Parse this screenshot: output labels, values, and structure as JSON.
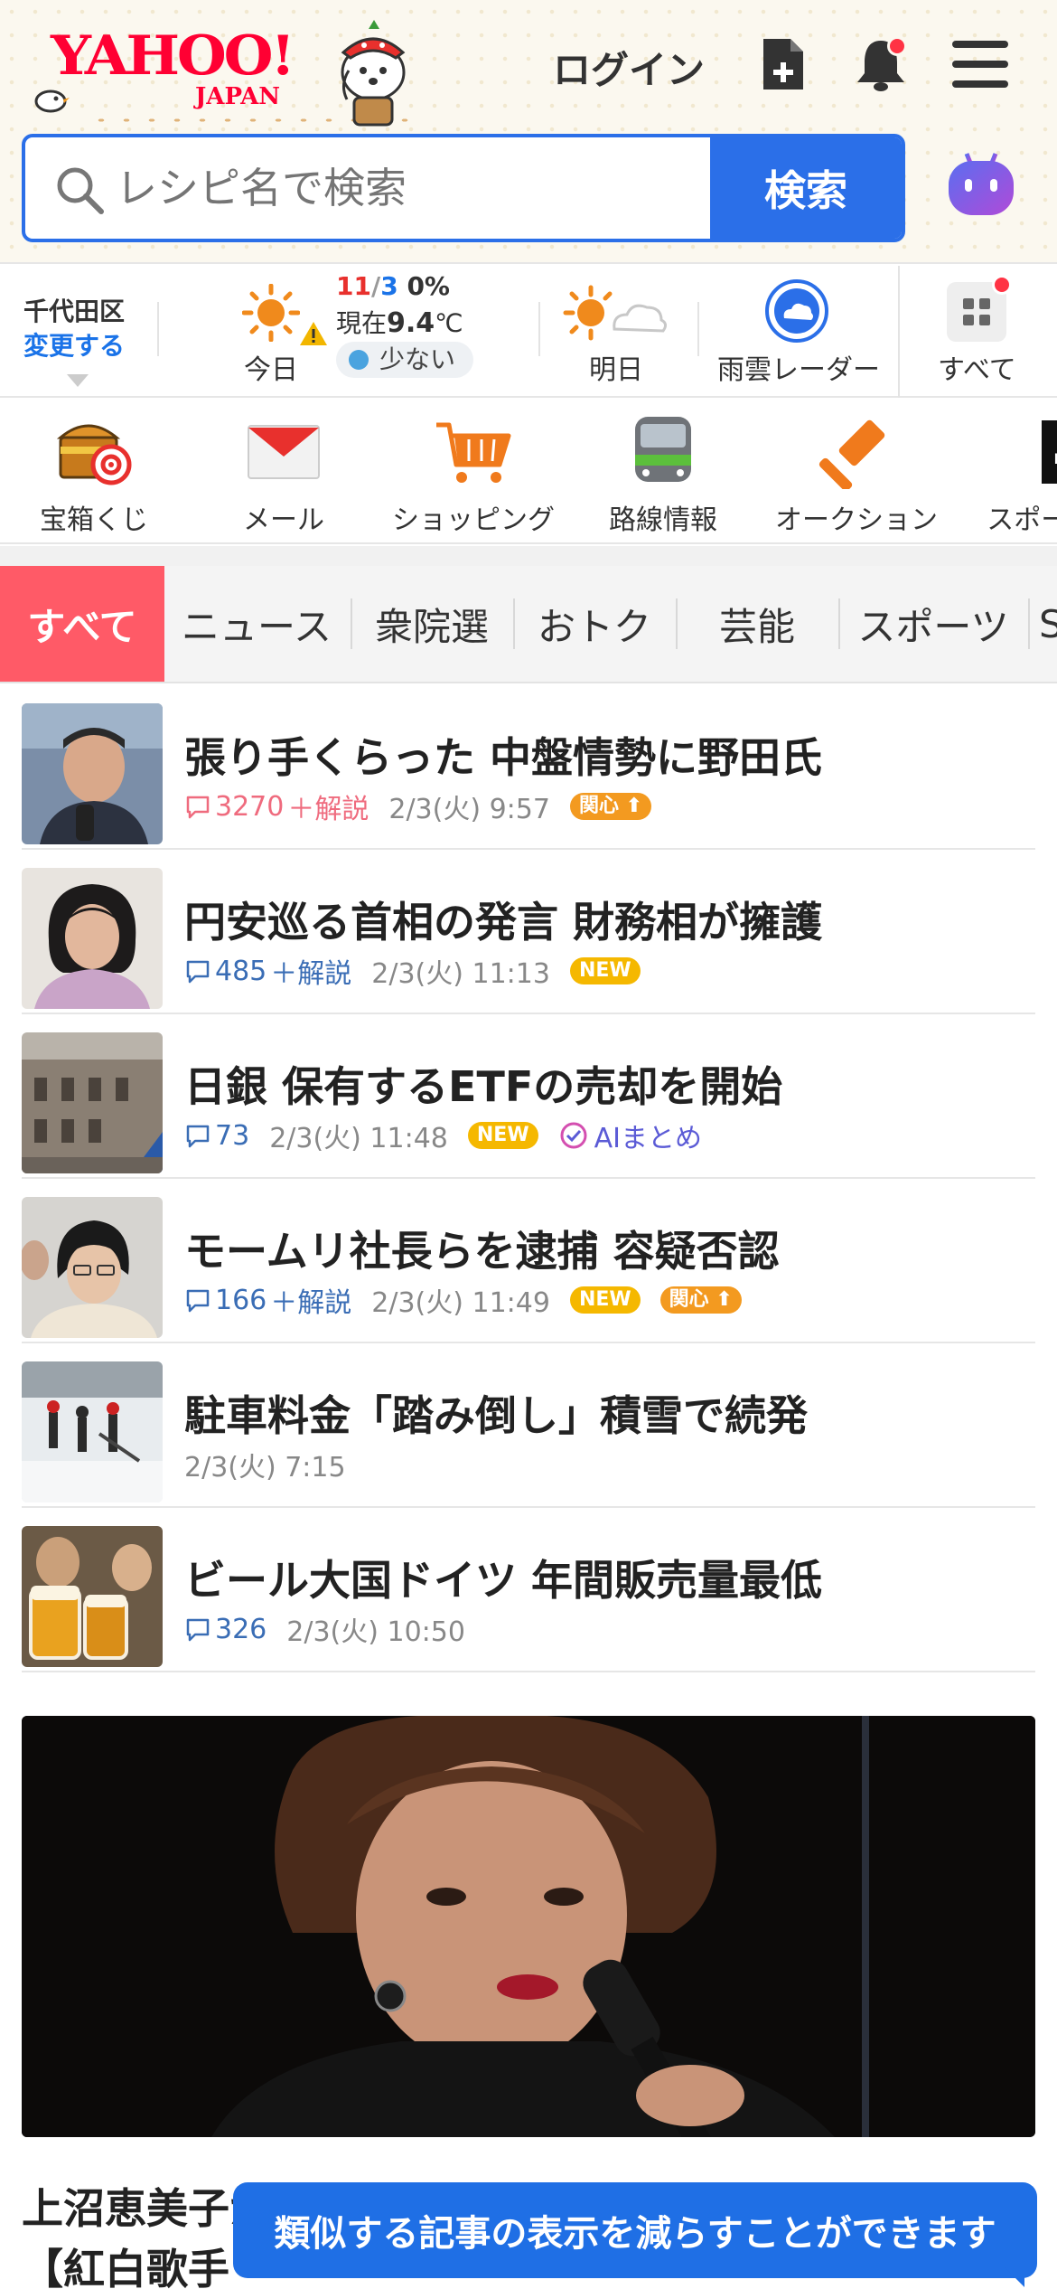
{
  "header": {
    "logo_text": "YAHOO!",
    "logo_sub": "JAPAN",
    "login_label": "ログイン"
  },
  "search": {
    "placeholder": "レシピ名で検索",
    "button_label": "検索"
  },
  "weather": {
    "location": "千代田区",
    "change_label": "変更する",
    "today_label": "今日",
    "high": "11",
    "low": "3",
    "precip": "0%",
    "now_prefix": "現在",
    "now_temp": "9.4",
    "now_unit": "℃",
    "rain_label": "少ない",
    "tomorrow_label": "明日",
    "radar_label": "雨雲レーダー",
    "all_label": "すべて"
  },
  "services": [
    {
      "label": "宝箱くじ",
      "icon": "treasure-chest-icon"
    },
    {
      "label": "メール",
      "icon": "mail-icon"
    },
    {
      "label": "ショッピング",
      "icon": "cart-icon"
    },
    {
      "label": "路線情報",
      "icon": "train-icon"
    },
    {
      "label": "オークション",
      "icon": "auction-hammer-icon"
    },
    {
      "label": "スポーツ",
      "icon": "sports-icon"
    }
  ],
  "tabs": [
    "すべて",
    "ニュース",
    "衆院選",
    "おトク",
    "芸能",
    "スポーツ",
    "S"
  ],
  "news": [
    {
      "title": "張り手くらった 中盤情勢に野田氏",
      "comments": "3270",
      "plus": "＋解説",
      "time": "2/3(火) 9:57",
      "badge": "関心"
    },
    {
      "title": "円安巡る首相の発言 財務相が擁護",
      "comments": "485",
      "plus": "＋解説",
      "time": "2/3(火) 11:13",
      "badge": "NEW"
    },
    {
      "title": "日銀 保有するETFの売却を開始",
      "comments": "73",
      "time": "2/3(火) 11:48",
      "badge": "NEW",
      "ai": "AIまとめ"
    },
    {
      "title": "モームリ社長らを逮捕 容疑否認",
      "comments": "166",
      "plus": "＋解説",
      "time": "2/3(火) 11:49",
      "badge": "NEW",
      "badge2": "関心"
    },
    {
      "title": "駐車料金「踏み倒し」積雪で続発",
      "time": "2/3(火) 7:15"
    },
    {
      "title": "ビール大国ドイツ 年間販売量最低",
      "comments": "326",
      "time": "2/3(火) 10:50"
    }
  ],
  "feature": {
    "title_line1": "上沼恵美子が「抜群だった！すてき」と大絶賛した",
    "title_line2": "【紅白歌手"
  },
  "toast": {
    "message": "類似する記事の表示を減らすことができます"
  },
  "colors": {
    "accent_blue": "#2b6fe8",
    "tab_active": "#ff5a67",
    "yahoo_red": "#ff0033"
  }
}
